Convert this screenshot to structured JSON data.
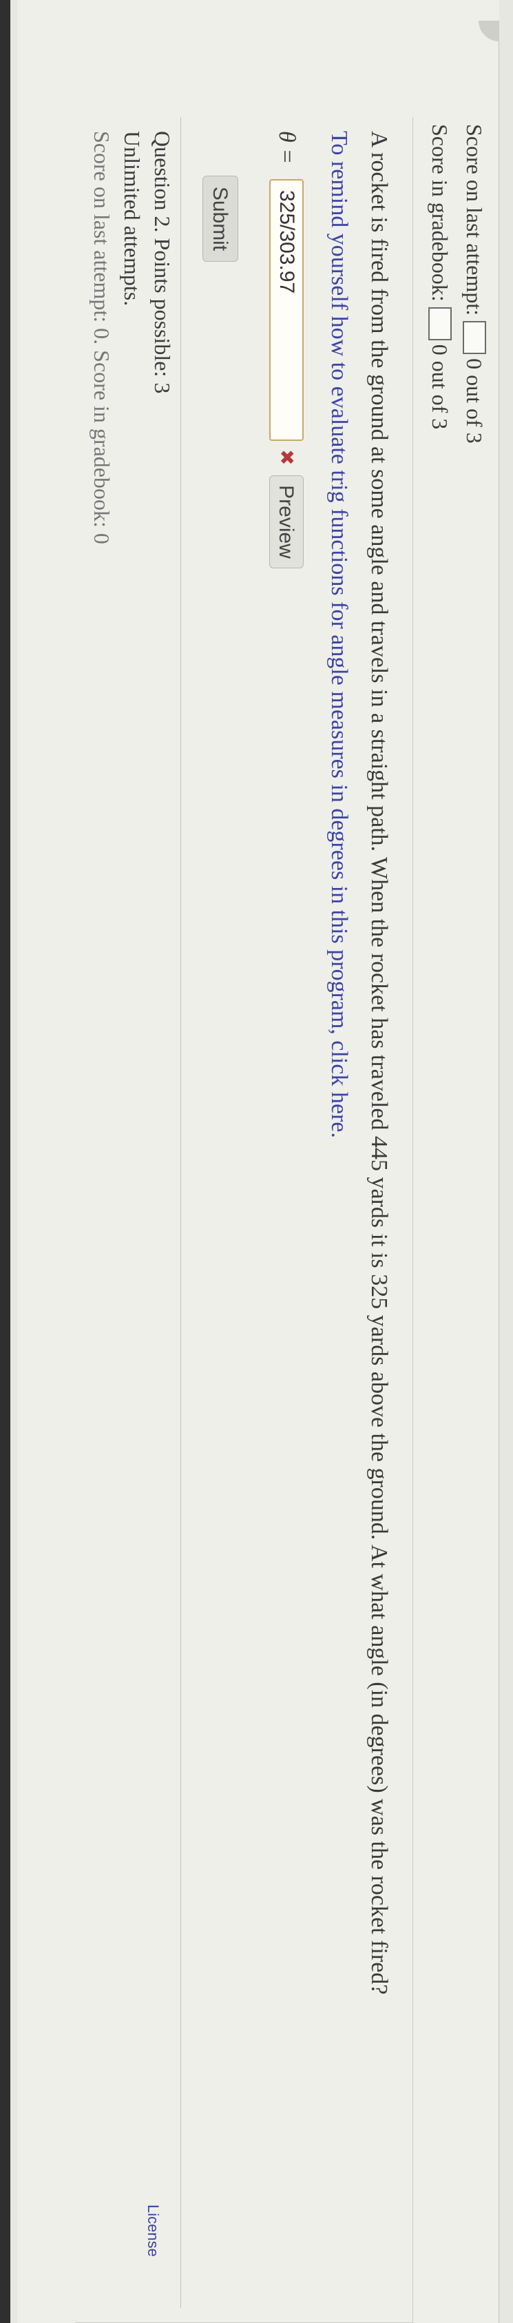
{
  "scores": {
    "last_attempt_label": "Score on last attempt:",
    "last_attempt_value": "0 out of 3",
    "gradebook_label": "Score in gradebook:",
    "gradebook_value": "0 out of 3"
  },
  "question": {
    "text": "A rocket is fired from the ground at some angle and travels in a straight path. When the rocket has traveled 445 yards it is 325 yards above the ground. At what angle (in degrees) was the rocket fired?",
    "help_link": "To remind yourself how to evaluate trig functions for angle measures in degrees in this program, click here.",
    "answer_label": "θ =",
    "answer_value": "325/303.97",
    "preview_label": "Preview",
    "submit_label": "Submit"
  },
  "next_question": {
    "title": "Question 2. Points possible: 3",
    "attempts": "Unlimited attempts.",
    "faded_line": "Score on last attempt: 0. Score in gradebook: 0"
  },
  "footer": {
    "license_link": "License"
  },
  "colors": {
    "link": "#3c43a8",
    "error": "#b53a3a",
    "input_border": "#c9a86a"
  }
}
